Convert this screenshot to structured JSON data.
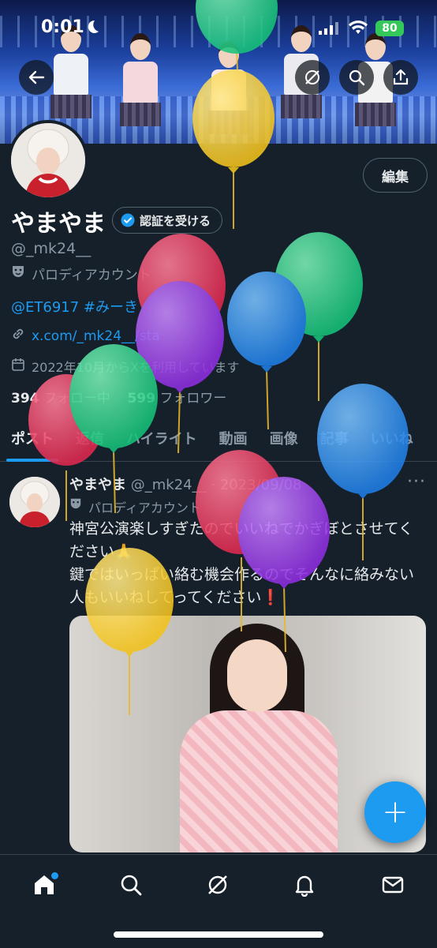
{
  "status_bar": {
    "time": "0:01",
    "battery": "80"
  },
  "header": {
    "back_icon": "back-arrow-icon",
    "grok_icon": "grok-icon",
    "search_icon": "search-icon",
    "share_icon": "share-icon"
  },
  "profile": {
    "display_name": "やまやま",
    "verify_label": "認証を受ける",
    "edit_label": "編集",
    "handle": "@_mk24__",
    "parody_label": "パロディアカウント",
    "bio": "@ET6917 #みーき",
    "link": "x.com/_mk24__/sta",
    "joined": "2022年10月からXを利用しています",
    "following_count": "394",
    "following_label": "フォロー中",
    "followers_count": "599",
    "followers_label": "フォロワー"
  },
  "tabs": [
    "ポスト",
    "返信",
    "ハイライト",
    "動画",
    "画像",
    "記事",
    "いいね"
  ],
  "post": {
    "author": "やまやま",
    "meta": "@_mk24__ · 2023/09/08",
    "label": "パロディアカウント",
    "text": "神宮公演楽しすぎたのでいいねでかぎぼとさせてください🙏\n鍵ではいっぱい絡む機会作るのでそんなに絡みない人もいいねしてってください❗️"
  },
  "fab_label": "+",
  "bottom_nav": [
    "home-icon",
    "search-icon",
    "grok-icon",
    "bell-icon",
    "mail-icon"
  ],
  "colors": {
    "accent": "#1d9bf0",
    "background": "#15202b",
    "muted": "#8b98a5"
  }
}
